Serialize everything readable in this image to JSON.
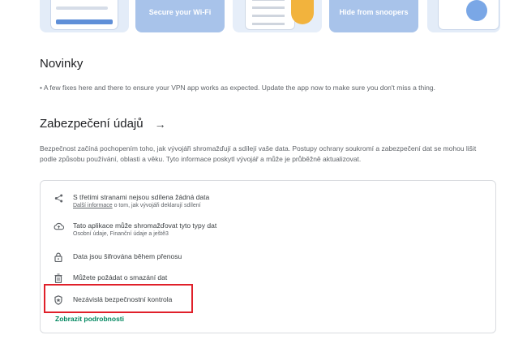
{
  "screenshots": [
    {
      "caption": ""
    },
    {
      "caption": "Secure your Wi-Fi"
    },
    {
      "caption": ""
    },
    {
      "caption": "Hide from snoopers"
    },
    {
      "caption": ""
    }
  ],
  "news": {
    "title": "Novinky",
    "text": "• A few fixes here and there to ensure your VPN app works as expected. Update the app now to make sure you don't miss a thing."
  },
  "safety": {
    "title": "Zabezpečení údajů",
    "arrow": "→",
    "description": "Bezpečnost začíná pochopením toho, jak vývojáři shromažďují a sdílejí vaše data. Postupy ochrany soukromí a zabezpečení dat se mohou lišit podle způsobu používání, oblasti a věku. Tyto informace poskytl vývojář a může je průběžně aktualizovat.",
    "items": [
      {
        "icon": "share-icon",
        "title": "S třetími stranami nejsou sdílena žádná data",
        "sub_link": "Další informace",
        "sub_rest": " o tom, jak vývojáři deklarují sdílení"
      },
      {
        "icon": "cloud-upload-icon",
        "title": "Tato aplikace může shromažďovat tyto typy dat",
        "sub": "Osobní údaje, Finanční údaje a ještě3"
      },
      {
        "icon": "lock-icon",
        "title": "Data jsou šifrována během přenosu"
      },
      {
        "icon": "trash-icon",
        "title": "Můžete požádat o smazání dat"
      },
      {
        "icon": "shield-icon",
        "title": "Nezávislá bezpečnostní kontrola"
      }
    ],
    "details_link": "Zobrazit podrobnosti"
  },
  "colors": {
    "accent_green": "#01875f",
    "highlight_red": "#e0202a"
  }
}
